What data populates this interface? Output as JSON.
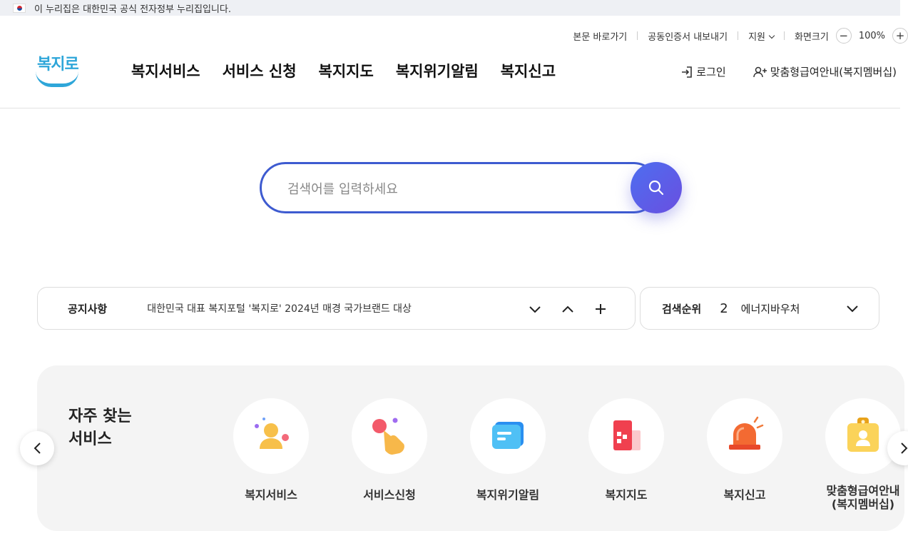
{
  "gov_banner": {
    "text": "이 누리집은 대한민국 공식 전자정부 누리집입니다."
  },
  "utility": {
    "skip_link": "본문 바로가기",
    "cert_export": "공동인증서 내보내기",
    "support": "지원",
    "zoom_label": "화면크기",
    "zoom_minus": "−",
    "zoom_value": "100%",
    "zoom_plus": "+"
  },
  "logo": {
    "text": "복지로"
  },
  "gnb": {
    "items": [
      {
        "label": "복지서비스"
      },
      {
        "label": "서비스 신청"
      },
      {
        "label": "복지지도"
      },
      {
        "label": "복지위기알림"
      },
      {
        "label": "복지신고"
      }
    ]
  },
  "header_right": {
    "login": "로그인",
    "membership": "맞춤형급여안내(복지멤버십)"
  },
  "search": {
    "placeholder": "검색어를 입력하세요",
    "value": ""
  },
  "notice": {
    "label": "공지사항",
    "text": "대한민국 대표 복지포털 '복지로' 2024년 매경 국가브랜드 대상"
  },
  "rank": {
    "label": "검색순위",
    "number": "2",
    "term": "에너지바우처"
  },
  "favorites": {
    "title_line1": "자주 찾는",
    "title_line2": "서비스",
    "items": [
      {
        "label": "복지서비스",
        "icon": "person-icon"
      },
      {
        "label": "서비스신청",
        "icon": "hand-pointer-icon"
      },
      {
        "label": "복지위기알림",
        "icon": "chat-bubble-icon"
      },
      {
        "label": "복지지도",
        "icon": "building-icon"
      },
      {
        "label": "복지신고",
        "icon": "siren-icon"
      },
      {
        "label": "맞춤형급여안내",
        "label2": "(복지멤버십)",
        "icon": "id-badge-icon"
      }
    ]
  },
  "colors": {
    "accent": "#3e5bd0",
    "logo": "#2ea6d9",
    "search_button": "#5a5fe8"
  }
}
